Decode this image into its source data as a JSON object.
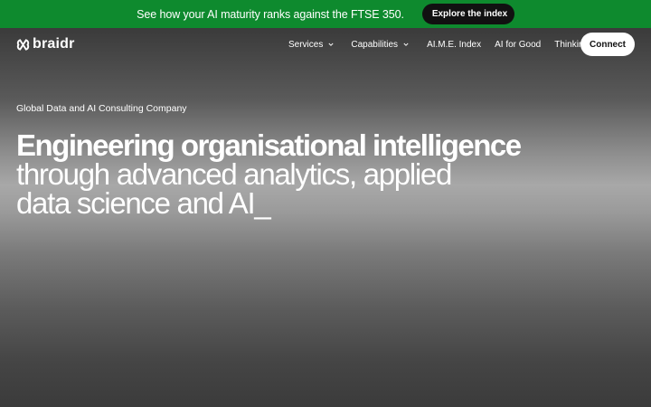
{
  "promo": {
    "text": "See how your AI maturity ranks against the FTSE 350.",
    "button_label": "Explore the index"
  },
  "nav": {
    "logo_text": "braidr",
    "items": [
      {
        "label": "Services",
        "has_dropdown": true
      },
      {
        "label": "Capabilities",
        "has_dropdown": true
      },
      {
        "label": "AI.M.E. Index",
        "has_dropdown": false
      },
      {
        "label": "AI for Good",
        "has_dropdown": false
      },
      {
        "label": "Thinking",
        "has_dropdown": false
      }
    ],
    "cta_label": "Connect"
  },
  "hero": {
    "eyebrow": "Global Data and AI Consulting Company",
    "title_strong": "Engineering organisational intelligence",
    "title_line2": "through advanced analytics, applied",
    "title_line3": "data science and AI_"
  },
  "colors": {
    "promo_bg": "#0e8a2e",
    "promo_button_bg": "#111111",
    "text": "#ffffff",
    "cta_bg": "#ffffff",
    "cta_text": "#111111"
  },
  "icons": {
    "logo": "braid-knot-icon",
    "dropdown": "chevron-down-icon"
  }
}
